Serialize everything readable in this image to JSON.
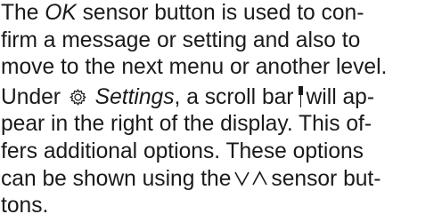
{
  "paragraph1": {
    "line1_pre": "The ",
    "line1_ok": "OK",
    "line1_post": " sensor button is used to con-",
    "line2": "firm a message or setting and also to",
    "line3": "move to the next menu or another level."
  },
  "paragraph2": {
    "line1_pre": "Under ",
    "settings_label": "Settings",
    "line1_post": ", a scroll bar",
    "line1_end": "will ap-",
    "line2": "pear in the right of the display. This of-",
    "line3": "fers additional options. These options",
    "line4_pre": "can be shown using the",
    "line4_post": "sensor but-",
    "line5": "tons."
  },
  "icons": {
    "settings": "gear-icon",
    "scrollbar": "scrollbar-icon",
    "arrows": "down-up-arrows-icon"
  }
}
